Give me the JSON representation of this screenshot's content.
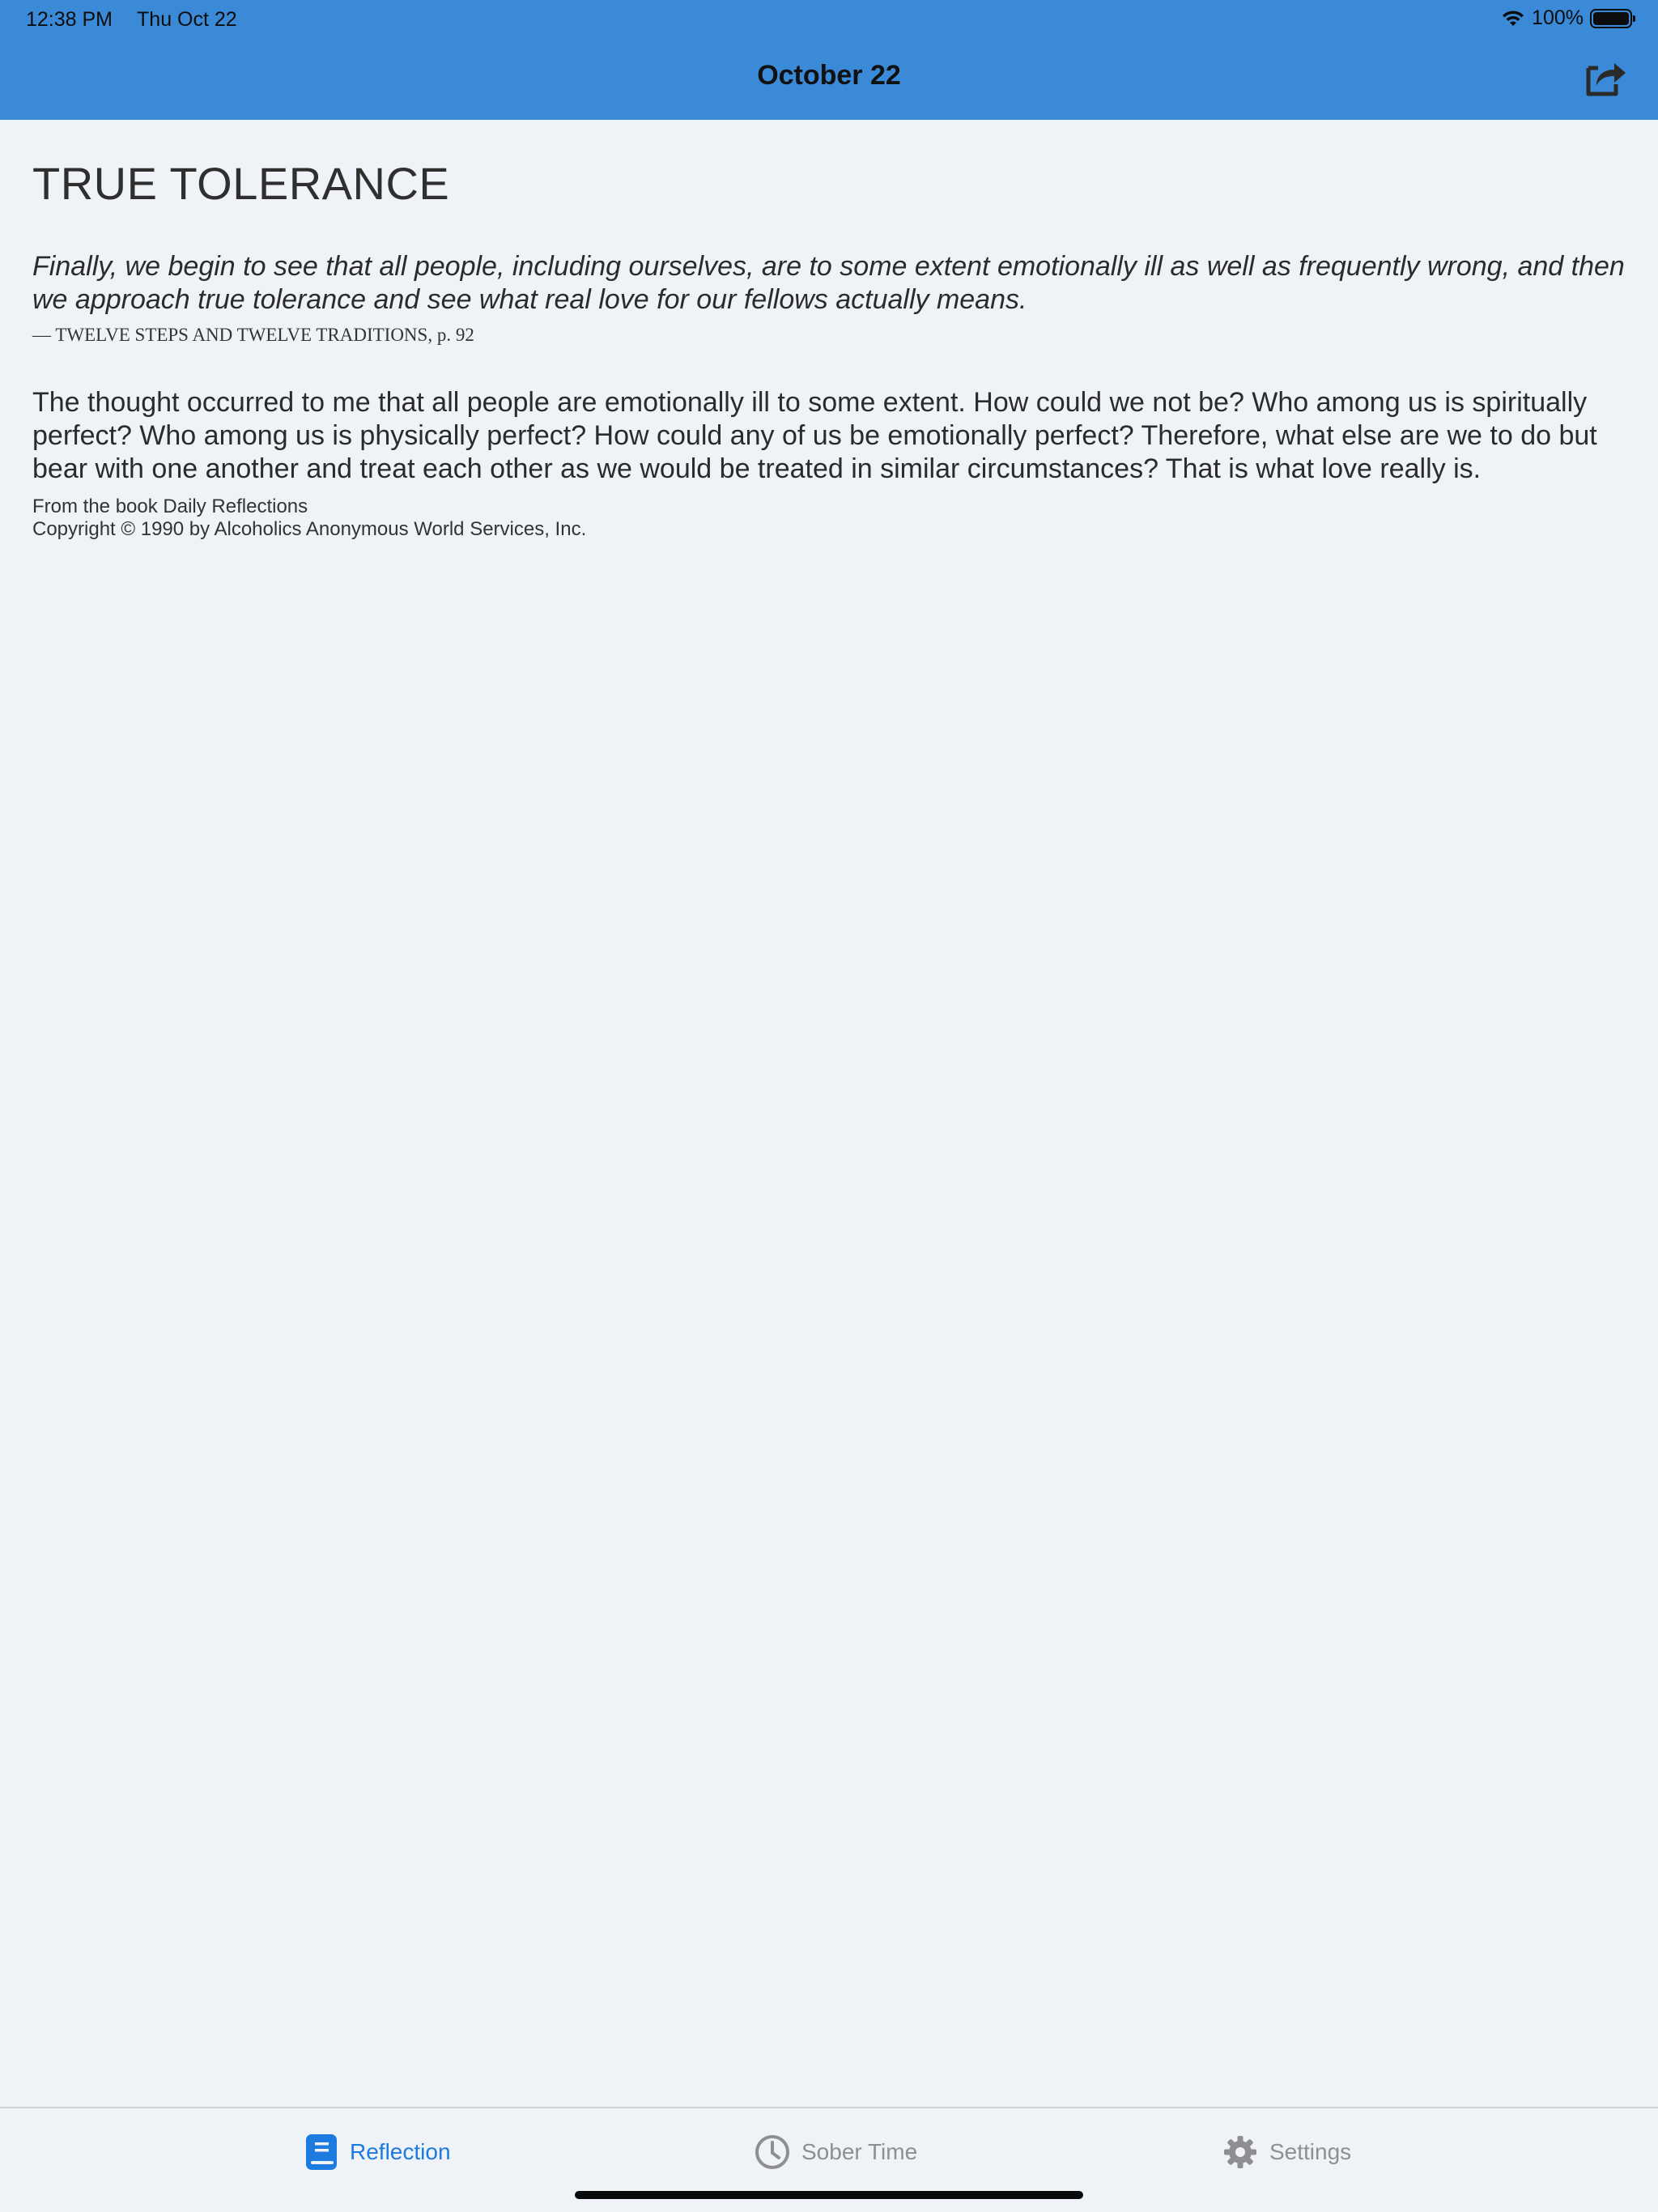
{
  "status_bar": {
    "time": "12:38 PM",
    "date": "Thu Oct 22",
    "battery": "100%"
  },
  "nav": {
    "title": "October 22",
    "share_icon": "share-icon"
  },
  "reflection": {
    "title": "TRUE TOLERANCE",
    "quote": "Finally, we begin to see that all people, including ourselves, are to some extent emotionally ill as well as frequently wrong, and then we approach true tolerance and see what real love for our fellows actually means.",
    "citation": "— TWELVE STEPS AND TWELVE TRADITIONS, p. 92",
    "body": "The thought occurred to me that all people are emotionally ill to some extent. How could we not be? Who among us is spiritually perfect? Who among us is physically perfect? How could any of us be emotionally perfect? Therefore, what else are we to do but bear with one another and treat each other as we would be treated in similar circumstances? That is what love really is.",
    "source_line1": "From the book Daily Reflections",
    "source_line2": "Copyright © 1990 by Alcoholics Anonymous World Services, Inc."
  },
  "tabs": [
    {
      "label": "Reflection",
      "icon": "book-icon",
      "active": true
    },
    {
      "label": "Sober Time",
      "icon": "clock-icon",
      "active": false
    },
    {
      "label": "Settings",
      "icon": "gear-icon",
      "active": false
    }
  ],
  "colors": {
    "header": "#3a8ad8",
    "background": "#eff3f7",
    "active_tab": "#1d7be0",
    "inactive_tab": "#8e8e93"
  }
}
